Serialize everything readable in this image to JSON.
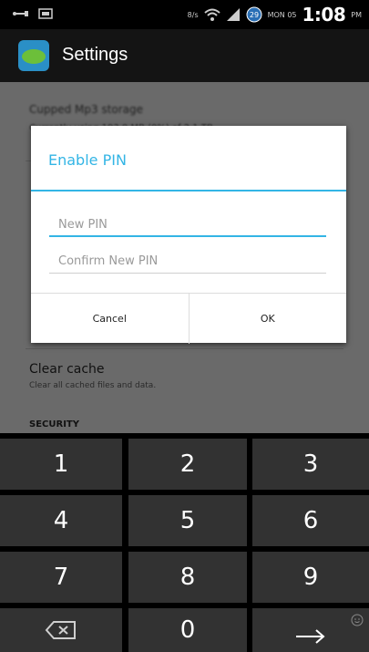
{
  "status_bar": {
    "network_label": "8/s",
    "day_label": "MON 05",
    "time": "1:08",
    "ampm": "PM"
  },
  "action_bar": {
    "title": "Settings"
  },
  "background_list": {
    "top_title": "Cupped Mp3 storage",
    "top_subtitle": "Currently using 193.0 MB (0%) of 2.1 TB",
    "clear_cache_title": "Clear cache",
    "clear_cache_subtitle": "Clear all cached files and data.",
    "section_header": "SECURITY"
  },
  "dialog": {
    "title": "Enable PIN",
    "new_pin_placeholder": "New PIN",
    "confirm_pin_placeholder": "Confirm New PIN",
    "cancel_label": "Cancel",
    "ok_label": "OK"
  },
  "keyboard": {
    "keys": [
      "1",
      "2",
      "3",
      "4",
      "5",
      "6",
      "7",
      "8",
      "9",
      "⌫",
      "0",
      "→"
    ]
  },
  "colors": {
    "accent": "#33b5e5",
    "dim_background": "#6a6a6a",
    "key_background": "#323232"
  },
  "icons": [
    "wifi-icon",
    "signal-icon",
    "clock-badge-icon",
    "backspace-icon",
    "enter-arrow-icon",
    "emoji-icon"
  ]
}
